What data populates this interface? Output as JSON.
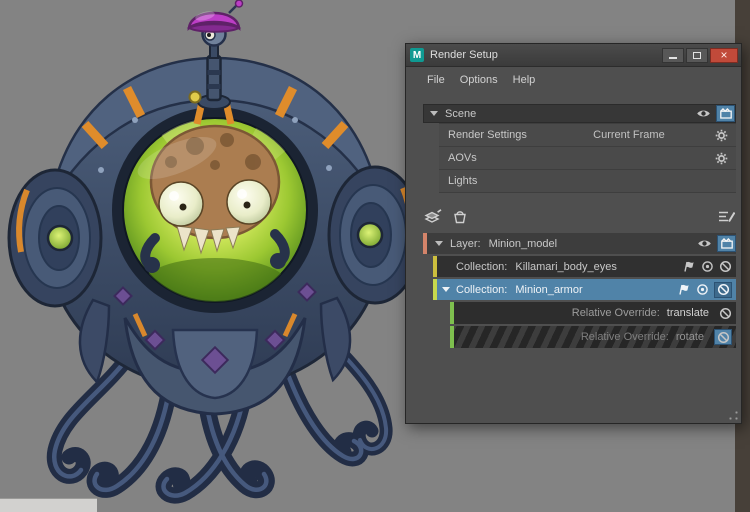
{
  "window": {
    "title": "Render Setup",
    "logo_letter": "M",
    "icons": {
      "close_glyph": "×"
    },
    "menu": [
      "File",
      "Options",
      "Help"
    ],
    "scene": {
      "label": "Scene"
    },
    "panel": {
      "render_settings": {
        "label": "Render Settings",
        "value": "Current Frame"
      },
      "aovs": {
        "label": "AOVs"
      },
      "lights": {
        "label": "Lights"
      }
    },
    "layer": {
      "prefix": "Layer:",
      "name": "Minion_model"
    },
    "collections": [
      {
        "prefix": "Collection:",
        "name": "Killamari_body_eyes"
      },
      {
        "prefix": "Collection:",
        "name": "Minion_armor"
      }
    ],
    "overrides": [
      {
        "prefix": "Relative Override:",
        "name": "translate"
      },
      {
        "prefix": "Relative Override:",
        "name": "rotate"
      }
    ]
  },
  "colors": {
    "selection_blue": "#5083a8",
    "layer_stripe": "#d4846a",
    "collection_stripe": "#cdbf3e",
    "selected_collection_stripe": "#c6d94e",
    "override_stripe": "#7ebf4e",
    "close_red": "#c14a3a",
    "maya_teal": "#0f9a92",
    "desktop_gray": "#838383"
  }
}
